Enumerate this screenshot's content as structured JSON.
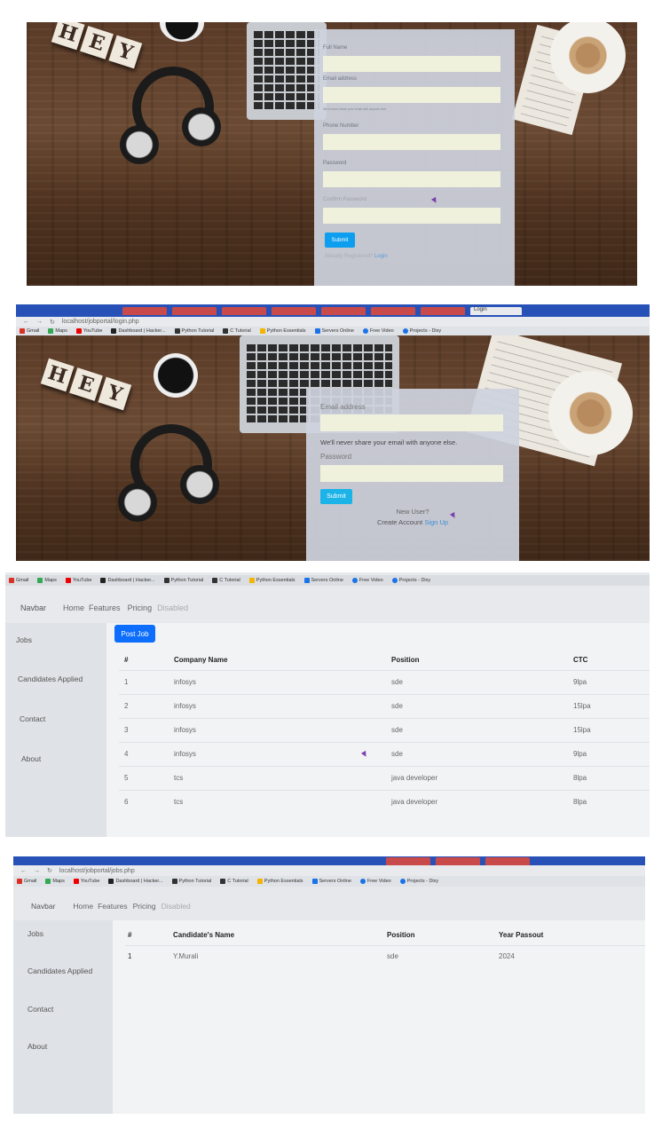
{
  "panel1": {
    "fields": [
      {
        "label": "Full Name",
        "value": ""
      },
      {
        "label": "Email address",
        "value": ""
      },
      {
        "label": "Phone Number",
        "value": ""
      },
      {
        "label": "Password",
        "value": ""
      },
      {
        "label": "Confirm Password",
        "value": ""
      }
    ],
    "email_help": "We'll never share your email with anyone else.",
    "submit_label": "Submit",
    "already_registered": "Already Registered?",
    "login_link": "Login"
  },
  "panel2": {
    "url": "localhost/jobportal/login.php",
    "tab_label": "Login",
    "email_label": "Email address",
    "email_help": "We'll never share your email with anyone else.",
    "password_label": "Password",
    "submit_label": "Submit",
    "new_user": "New User?",
    "create_account": "Create Account",
    "signup_link": "Sign Up"
  },
  "bookmarks": [
    "Gmail",
    "Maps",
    "YouTube",
    "Dashboard | Hacker...",
    "Python Tutorial",
    "C Tutorial",
    "Python Essentials",
    "Servers Online",
    "Free Video",
    "Projects - Dixy"
  ],
  "dashboard": {
    "navbar": {
      "brand": "Navbar",
      "links": [
        "Home",
        "Features",
        "Pricing"
      ],
      "disabled": "Disabled"
    },
    "sidebar": [
      "Jobs",
      "Candidates Applied",
      "Contact",
      "About"
    ],
    "post_job_label": "Post Job",
    "table": {
      "headers": [
        "#",
        "Company Name",
        "Position",
        "CTC"
      ],
      "rows": [
        [
          "1",
          "infosys",
          "sde",
          "9lpa"
        ],
        [
          "2",
          "infosys",
          "sde",
          "15lpa"
        ],
        [
          "3",
          "infosys",
          "sde",
          "15lpa"
        ],
        [
          "4",
          "infosys",
          "sde",
          "9lpa"
        ],
        [
          "5",
          "tcs",
          "java developer",
          "8lpa"
        ],
        [
          "6",
          "tcs",
          "java developer",
          "8lpa"
        ]
      ]
    }
  },
  "applied": {
    "url": "localhost/jobportal/jobs.php",
    "table": {
      "headers": [
        "#",
        "Candidate's Name",
        "Position",
        "Year Passout"
      ],
      "rows": [
        [
          "1",
          "Y.Murali",
          "sde",
          "2024"
        ]
      ]
    }
  }
}
